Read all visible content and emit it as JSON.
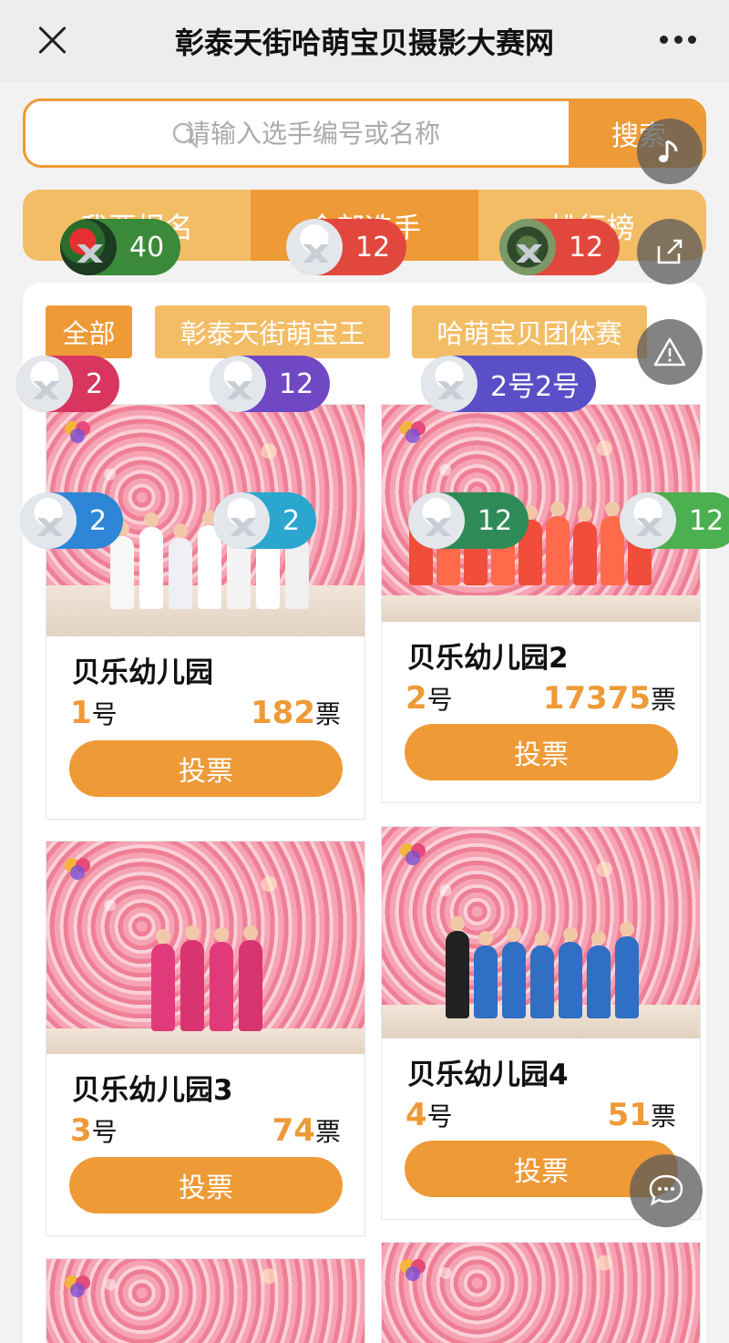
{
  "header": {
    "title": "彰泰天街哈萌宝贝摄影大赛网"
  },
  "search": {
    "placeholder": "请输入选手编号或名称",
    "button_label": "搜索"
  },
  "tabs": [
    {
      "label": "我要报名"
    },
    {
      "label": "全部选手"
    },
    {
      "label": "排行榜"
    }
  ],
  "filters": [
    {
      "label": "全部"
    },
    {
      "label": "彰泰天街萌宝王"
    },
    {
      "label": "哈萌宝贝团体赛"
    }
  ],
  "players": [
    {
      "name": "贝乐幼儿园",
      "number": "1",
      "number_suffix": "号",
      "votes": "182",
      "votes_suffix": "票",
      "vote_label": "投票"
    },
    {
      "name": "贝乐幼儿园2",
      "number": "2",
      "number_suffix": "号",
      "votes": "17375",
      "votes_suffix": "票",
      "vote_label": "投票"
    },
    {
      "name": "贝乐幼儿园3",
      "number": "3",
      "number_suffix": "号",
      "votes": "74",
      "votes_suffix": "票",
      "vote_label": "投票"
    },
    {
      "name": "贝乐幼儿园4",
      "number": "4",
      "number_suffix": "号",
      "votes": "51",
      "votes_suffix": "票",
      "vote_label": "投票"
    }
  ],
  "overlay_bubbles": [
    {
      "text": "40",
      "color": "#3a8a3a"
    },
    {
      "text": "12",
      "color": "#e2473e"
    },
    {
      "text": "12",
      "color": "#e2473e"
    },
    {
      "text": "2",
      "color": "#d8355f"
    },
    {
      "text": "12",
      "color": "#7048c4"
    },
    {
      "text": "2号2号",
      "color": "#5a4fc6"
    },
    {
      "text": "2",
      "color": "#2e86d6"
    },
    {
      "text": "2",
      "color": "#2aa6cf"
    },
    {
      "text": "12",
      "color": "#2e8b57"
    },
    {
      "text": "12",
      "color": "#4caf50"
    }
  ],
  "float_buttons": [
    "music-icon",
    "share-icon",
    "warning-icon",
    "chat-icon"
  ]
}
